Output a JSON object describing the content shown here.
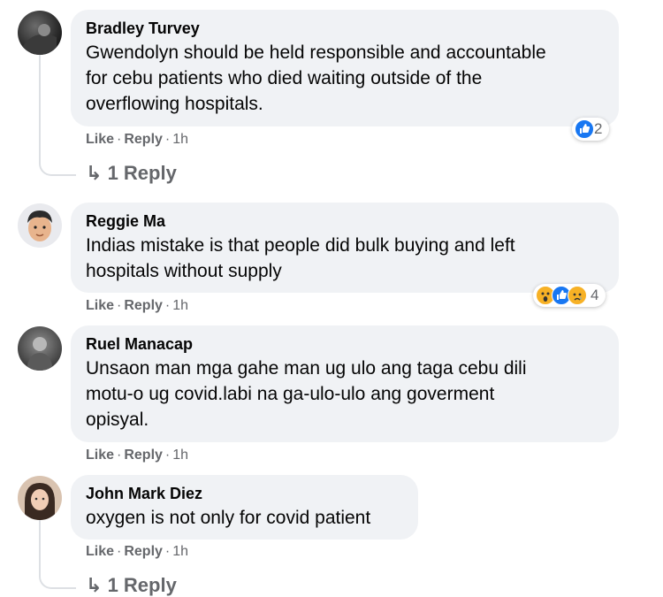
{
  "comments": [
    {
      "author": "Bradley Turvey",
      "lines": [
        "Gwendolyn should be held responsible and accountable",
        "for cebu patients who died waiting outside of the",
        "overflowing hospitals."
      ],
      "like": "Like",
      "reply": "Reply",
      "time": "1h",
      "reaction_count": "2",
      "reactions": [
        "like-icon"
      ],
      "replies": "1 Reply"
    },
    {
      "author": "Reggie Ma",
      "lines": [
        "Indias mistake is that people did bulk buying and left",
        "hospitals without supply"
      ],
      "like": "Like",
      "reply": "Reply",
      "time": "1h",
      "reaction_count": "4",
      "reactions": [
        "wow-icon",
        "like-icon",
        "sad-icon"
      ]
    },
    {
      "author": "Ruel Manacap",
      "lines": [
        "Unsaon man mga gahe man ug ulo ang taga cebu dili",
        "motu-o ug covid.labi na ga-ulo-ulo ang goverment",
        "opisyal."
      ],
      "like": "Like",
      "reply": "Reply",
      "time": "1h"
    },
    {
      "author": "John Mark Diez",
      "lines": [
        "oxygen is not only for covid patient"
      ],
      "like": "Like",
      "reply": "Reply",
      "time": "1h",
      "replies": "1 Reply"
    }
  ],
  "colors": {
    "bubble": "#f0f2f5",
    "meta": "#65676b",
    "like_blue": "#1877f2",
    "emoji_yellow": "#f7b125"
  }
}
